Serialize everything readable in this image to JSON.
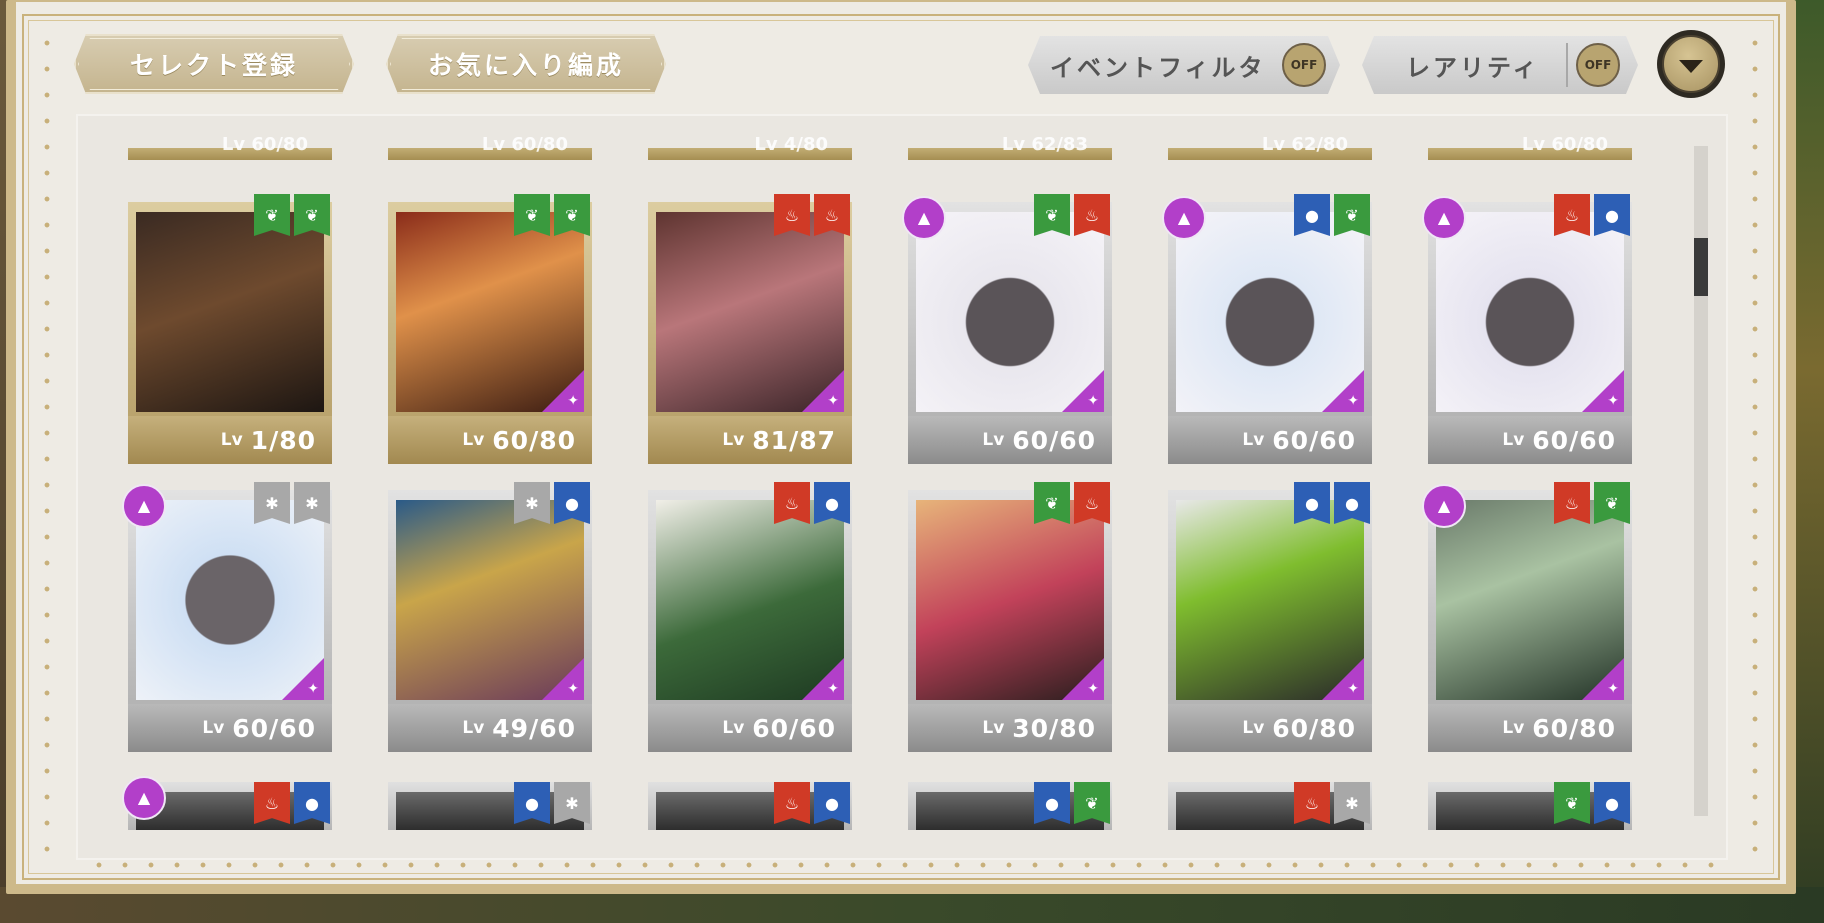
{
  "toolbar": {
    "select_register": "セレクト登録",
    "favorite_edit": "お気に入り編成",
    "event_filter": "イベントフィルタ",
    "event_filter_state": "OFF",
    "rarity": "レアリティ",
    "rarity_state": "OFF"
  },
  "lv_prefix": "Lv",
  "attribute_colors": {
    "green": "#3a9a3e",
    "red": "#d03a26",
    "blue": "#2d5fb5",
    "gray": "#a8a8a8"
  },
  "top_row_partial": [
    "60/80",
    "60/80",
    "4/80",
    "62/83",
    "62/80",
    "60/80"
  ],
  "cards": [
    {
      "level": "1/80",
      "frame": "gold",
      "attrs": [
        "green",
        "green"
      ],
      "uncapped": false,
      "sparkle": false
    },
    {
      "level": "60/80",
      "frame": "gold",
      "attrs": [
        "green",
        "green"
      ],
      "uncapped": false,
      "sparkle": true
    },
    {
      "level": "81/87",
      "frame": "gold",
      "attrs": [
        "red",
        "red"
      ],
      "uncapped": false,
      "sparkle": true
    },
    {
      "level": "60/60",
      "frame": "silver",
      "attrs": [
        "green",
        "red"
      ],
      "uncapped": true,
      "sparkle": true
    },
    {
      "level": "60/60",
      "frame": "silver",
      "attrs": [
        "blue",
        "green"
      ],
      "uncapped": true,
      "sparkle": true
    },
    {
      "level": "60/60",
      "frame": "silver",
      "attrs": [
        "red",
        "blue"
      ],
      "uncapped": true,
      "sparkle": true
    },
    {
      "level": "60/60",
      "frame": "silver",
      "attrs": [
        "gray",
        "gray"
      ],
      "uncapped": true,
      "sparkle": true
    },
    {
      "level": "49/60",
      "frame": "silver",
      "attrs": [
        "gray",
        "blue"
      ],
      "uncapped": false,
      "sparkle": true
    },
    {
      "level": "60/60",
      "frame": "silver",
      "attrs": [
        "red",
        "blue"
      ],
      "uncapped": false,
      "sparkle": true
    },
    {
      "level": "30/80",
      "frame": "silver",
      "attrs": [
        "green",
        "red"
      ],
      "uncapped": false,
      "sparkle": true
    },
    {
      "level": "60/80",
      "frame": "silver",
      "attrs": [
        "blue",
        "blue"
      ],
      "uncapped": false,
      "sparkle": true
    },
    {
      "level": "60/80",
      "frame": "silver",
      "attrs": [
        "red",
        "green"
      ],
      "uncapped": true,
      "sparkle": true
    }
  ],
  "bottom_row_partial": [
    {
      "attrs": [
        "red",
        "blue"
      ],
      "uncapped": true
    },
    {
      "attrs": [
        "blue",
        "gray"
      ],
      "uncapped": false
    },
    {
      "attrs": [
        "red",
        "blue"
      ],
      "uncapped": false
    },
    {
      "attrs": [
        "blue",
        "green"
      ],
      "uncapped": false
    },
    {
      "attrs": [
        "red",
        "gray"
      ],
      "uncapped": false
    },
    {
      "attrs": [
        "green",
        "blue"
      ],
      "uncapped": false
    }
  ]
}
